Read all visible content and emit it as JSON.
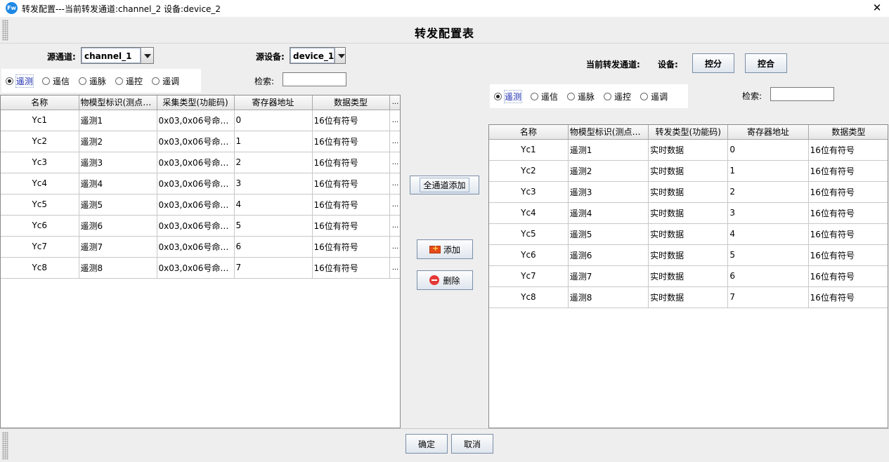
{
  "window": {
    "title": "转发配置---当前转发通道:channel_2  设备:device_2",
    "app_icon": "Fw",
    "close": "✕"
  },
  "header": {
    "title": "转发配置表"
  },
  "left": {
    "source_channel_label": "源通道:",
    "source_channel_value": "channel_1",
    "source_device_label": "源设备:",
    "source_device_value": "device_1",
    "search_label": "检索:",
    "search_value": "",
    "radios": [
      "遥测",
      "遥信",
      "遥脉",
      "遥控",
      "遥调"
    ],
    "selected_radio": "遥测",
    "columns": [
      "名称",
      "物模型标识(测点描...",
      "采集类型(功能码)",
      "寄存器地址",
      "数据类型",
      "..."
    ],
    "rows": [
      [
        "Yc1",
        "遥测1",
        "0x03,0x06号命令(...",
        "0",
        "16位有符号",
        "..."
      ],
      [
        "Yc2",
        "遥测2",
        "0x03,0x06号命令(...",
        "1",
        "16位有符号",
        "..."
      ],
      [
        "Yc3",
        "遥测3",
        "0x03,0x06号命令(...",
        "2",
        "16位有符号",
        "..."
      ],
      [
        "Yc4",
        "遥测4",
        "0x03,0x06号命令(...",
        "3",
        "16位有符号",
        "..."
      ],
      [
        "Yc5",
        "遥测5",
        "0x03,0x06号命令(...",
        "4",
        "16位有符号",
        "..."
      ],
      [
        "Yc6",
        "遥测6",
        "0x03,0x06号命令(...",
        "5",
        "16位有符号",
        "..."
      ],
      [
        "Yc7",
        "遥测7",
        "0x03,0x06号命令(...",
        "6",
        "16位有符号",
        "..."
      ],
      [
        "Yc8",
        "遥测8",
        "0x03,0x06号命令(...",
        "7",
        "16位有符号",
        "..."
      ]
    ]
  },
  "middle": {
    "add_all_label": "全通道添加",
    "add_label": "添加",
    "delete_label": "删除"
  },
  "right": {
    "current_channel_label": "当前转发通道:",
    "device_label": "设备:",
    "control_open_label": "控分",
    "control_close_label": "控合",
    "search_label": "检索:",
    "search_value": "",
    "radios": [
      "遥测",
      "遥信",
      "遥脉",
      "遥控",
      "遥调"
    ],
    "selected_radio": "遥测",
    "columns": [
      "名称",
      "物模型标识(测点描...",
      "转发类型(功能码)",
      "寄存器地址",
      "数据类型"
    ],
    "rows": [
      [
        "Yc1",
        "遥测1",
        "实时数据",
        "0",
        "16位有符号"
      ],
      [
        "Yc2",
        "遥测2",
        "实时数据",
        "1",
        "16位有符号"
      ],
      [
        "Yc3",
        "遥测3",
        "实时数据",
        "2",
        "16位有符号"
      ],
      [
        "Yc4",
        "遥测4",
        "实时数据",
        "3",
        "16位有符号"
      ],
      [
        "Yc5",
        "遥测5",
        "实时数据",
        "4",
        "16位有符号"
      ],
      [
        "Yc6",
        "遥测6",
        "实时数据",
        "5",
        "16位有符号"
      ],
      [
        "Yc7",
        "遥测7",
        "实时数据",
        "6",
        "16位有符号"
      ],
      [
        "Yc8",
        "遥测8",
        "实时数据",
        "7",
        "16位有符号"
      ]
    ]
  },
  "footer": {
    "ok_label": "确定",
    "cancel_label": "取消"
  },
  "icons": {
    "add": "flag-plus-icon",
    "delete": "minus-circle-icon"
  },
  "colors": {
    "selected_text": "#1a2bb0",
    "panel_bg": "#eeeeee",
    "app_icon": "#1e88e5",
    "delete_icon": "#e53935"
  }
}
